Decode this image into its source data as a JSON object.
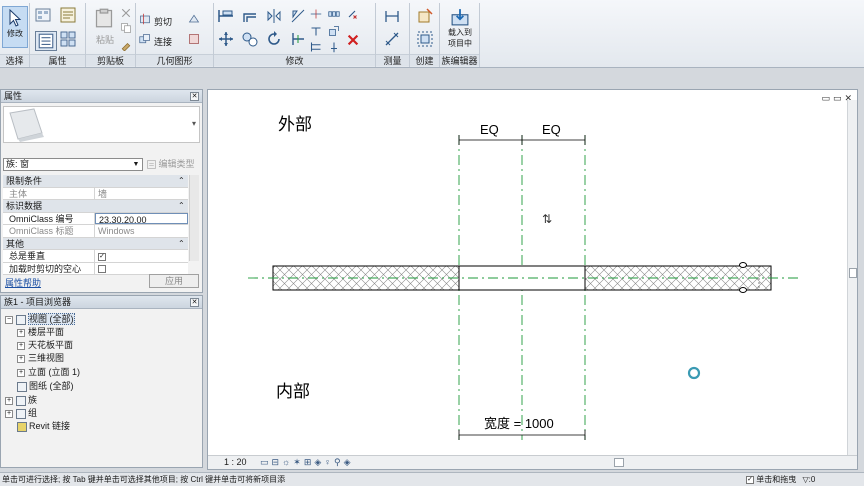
{
  "ribbon": {
    "groups": [
      {
        "label": "选择"
      },
      {
        "label": "属性"
      },
      {
        "label": "剪贴板"
      },
      {
        "label": "几何图形"
      },
      {
        "label": "修改"
      },
      {
        "label": "测量"
      },
      {
        "label": "创建"
      },
      {
        "label": "族编辑器"
      }
    ],
    "modify_label": "修改",
    "paste_label": "粘贴",
    "cut_label": "剪切",
    "join_label": "连接",
    "load_label_1": "载入到",
    "load_label_2": "项目中"
  },
  "properties": {
    "title": "属性",
    "type_value": "族: 窗",
    "edit_type_label": "编辑类型",
    "rows": [
      {
        "k": "限制条件",
        "cat": true
      },
      {
        "k": "主体",
        "v": "墙",
        "dim": true
      },
      {
        "k": "标识数据",
        "cat": true
      },
      {
        "k": "OmniClass 编号",
        "v": "23.30.20.00"
      },
      {
        "k": "OmniClass 标题",
        "v": "Windows",
        "dim": true
      },
      {
        "k": "其他",
        "cat": true
      },
      {
        "k": "总是垂直",
        "v": "",
        "check": true
      },
      {
        "k": "加载时剪切的空心",
        "v": "",
        "check": false
      }
    ],
    "help_link": "属性帮助",
    "apply_label": "应用"
  },
  "browser": {
    "title": "族1 - 项目浏览器",
    "items": [
      {
        "label": "视图 (全部)"
      },
      {
        "label": "楼层平面"
      },
      {
        "label": "天花板平面"
      },
      {
        "label": "三维视图"
      },
      {
        "label": "立面 (立面 1)"
      },
      {
        "label": "图纸 (全部)"
      },
      {
        "label": "族"
      },
      {
        "label": "组"
      },
      {
        "label": "Revit 链接"
      }
    ]
  },
  "view": {
    "exterior_label": "外部",
    "interior_label": "内部",
    "eq_left": "EQ",
    "eq_right": "EQ",
    "width_dim": "宽度 = 1000",
    "scale": "1 : 20"
  },
  "status": {
    "message": "单击可进行选择; 按 Tab 键并单击可选择其他项目; 按 Ctrl 键并单击可将新项目添",
    "drag_label": "单击和拖曳",
    "filter_count": ":0"
  },
  "colors": {
    "ref_plane": "#1e9a3a",
    "dimension": "#000000",
    "hatch": "#777777"
  }
}
